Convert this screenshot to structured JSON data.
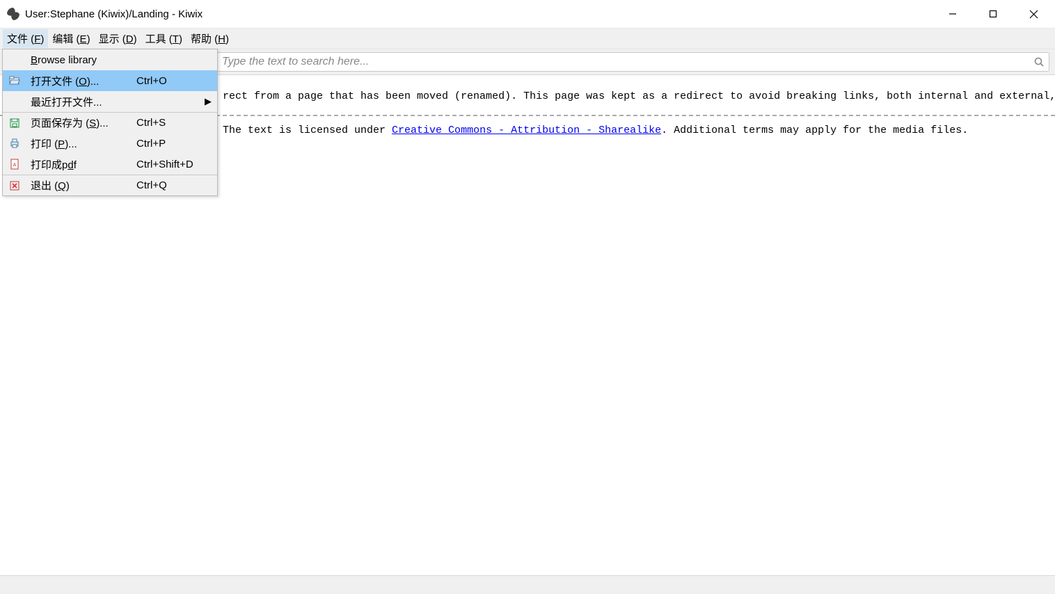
{
  "window": {
    "title": "User:Stephane (Kiwix)/Landing - Kiwix"
  },
  "menubar": {
    "items": [
      {
        "label": "文件",
        "accel": "F",
        "open": true
      },
      {
        "label": "编辑",
        "accel": "E",
        "open": false
      },
      {
        "label": "显示",
        "accel": "D",
        "open": false
      },
      {
        "label": "工具",
        "accel": "T",
        "open": false
      },
      {
        "label": "帮助",
        "accel": "H",
        "open": false
      }
    ]
  },
  "search": {
    "placeholder": "Type the text to search here..."
  },
  "file_menu": {
    "items": [
      {
        "icon": "",
        "label_pre": "",
        "label_u": "B",
        "label_post": "rowse library",
        "accel": "",
        "arrow": false,
        "hl": false
      },
      {
        "icon": "open",
        "label_pre": "打开文件 (",
        "label_u": "O",
        "label_post": ")...",
        "accel": "Ctrl+O",
        "arrow": false,
        "hl": true
      },
      {
        "icon": "",
        "label_pre": "最近打开文件...",
        "label_u": "",
        "label_post": "",
        "accel": "",
        "arrow": true,
        "hl": false
      },
      {
        "icon": "save",
        "label_pre": "页面保存为 (",
        "label_u": "S",
        "label_post": ")...",
        "accel": "Ctrl+S",
        "arrow": false,
        "hl": false
      },
      {
        "icon": "print",
        "label_pre": "打印 (",
        "label_u": "P",
        "label_post": ")...",
        "accel": "Ctrl+P",
        "arrow": false,
        "hl": false
      },
      {
        "icon": "pdf",
        "label_pre": "打印成p",
        "label_u": "d",
        "label_post": "f",
        "accel": "Ctrl+Shift+D",
        "arrow": false,
        "hl": false
      },
      {
        "icon": "exit",
        "label_pre": "退出 (",
        "label_u": "Q",
        "label_post": ")",
        "accel": "Ctrl+Q",
        "arrow": false,
        "hl": false
      }
    ]
  },
  "content": {
    "redirect_text": "rect from a page that has been moved (renamed). This page was kept as a redirect to avoid breaking links, both internal and external, that may have",
    "license_pre": "The text is licensed under ",
    "license_link": "Creative Commons - Attribution - Sharealike",
    "license_post": ". Additional terms may apply for the media files."
  }
}
